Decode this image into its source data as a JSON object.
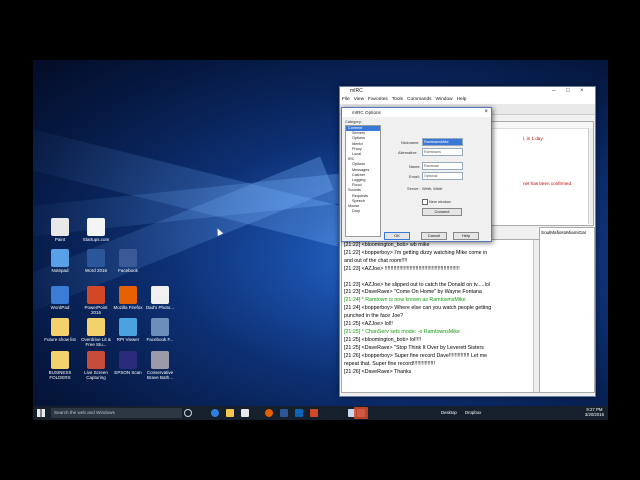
{
  "mirc": {
    "title": "mIRC",
    "menu": [
      "File",
      "View",
      "Favorites",
      "Tools",
      "Commands",
      "Window",
      "Help"
    ],
    "status_lines": [
      "l, in 1 day.",
      "net has been confirmed."
    ],
    "nicklist_top": "SoulMafiosoMiamiGar",
    "chat": [
      {
        "text": "[21:22] <bloomington_bob> wb mike",
        "color": "black"
      },
      {
        "text": "[21:22] <bopperboy> I'm getting dizzy watching Mike come in",
        "color": "black"
      },
      {
        "text": "  and out of the chat room!!!!",
        "color": "black"
      },
      {
        "text": "[21:23] <AZJoe> !!!!!!!!!!!!!!!!!!!!!!!!!!!!!!!!!!!!!!!!!!!!!!!!!!!",
        "color": "black"
      },
      {
        "text": "",
        "color": "black"
      },
      {
        "text": "[21:23] <AZJoe> he slipped out to catch  the Donald    on tv.....lol",
        "color": "black"
      },
      {
        "text": "[21:23] <DaveRave> \"Come On Home\" by Wayne Fontana",
        "color": "black"
      },
      {
        "text": "[21:24] * Ramtown is now known as RamtownsMike",
        "color": "green"
      },
      {
        "text": "[21:24] <bopperboy> Where else can you watch people getting",
        "color": "black"
      },
      {
        "text": "  punched in the face Joe?",
        "color": "black"
      },
      {
        "text": "[21:25] <AZJoe> lol!!",
        "color": "black"
      },
      {
        "text": "[21:25] * ChanServ sets mode: -o RamtownsMike",
        "color": "green"
      },
      {
        "text": "[21:25] <bloomington_bob> lol!!!!",
        "color": "black"
      },
      {
        "text": "[21:25] <DaveRave> \"Stop Think It Over by Leverett Sisters",
        "color": "black"
      },
      {
        "text": "[21:26] <bopperboy> Super fine record Dave!!!!!!!!!!!!!! Let me",
        "color": "black"
      },
      {
        "text": "  repeat that. Super fine record!!!!!!!!!!!!!!!",
        "color": "black"
      },
      {
        "text": "[21:26] <DaveRave> Thanks",
        "color": "black"
      }
    ]
  },
  "dialog": {
    "title": "mIRC Options",
    "category_label": "Category:",
    "tree": [
      "Connect",
      "Servers",
      "Options",
      "Identd",
      "Proxy",
      "Local",
      "IRC",
      "Options",
      "Messages",
      "Catcher",
      "Logging",
      "Flood",
      "Sounds",
      "Requests",
      "Speech",
      "Mouse",
      "Drop"
    ],
    "tree_selected": 0,
    "nickname_label": "Nickname:",
    "nickname_value": "RamtownsMike",
    "alternative_label": "Alternative:",
    "alternative_value": "Ramtowns",
    "name_label": "Name:",
    "name_value": "Ramtown",
    "email_label": "Email:",
    "email_value": "Optional",
    "server_label": "Server:",
    "server_value": "Wbtfr, Wbtfr",
    "new_window_label": "New window",
    "connect_label": "Connect",
    "ok": "OK",
    "cancel": "Cancel",
    "help": "Help"
  },
  "desktop_icons": [
    {
      "label": "Paint",
      "color": "#e8e8e8"
    },
    {
      "label": "Startups.com",
      "color": "#f4f4f4"
    },
    {
      "label": "Notepad",
      "color": "#5aa0e6"
    },
    {
      "label": "Word 2016",
      "color": "#2b579a"
    },
    {
      "label": "Facebook",
      "color": "#3b5998"
    },
    {
      "label": "WordPad",
      "color": "#3a7bd5"
    },
    {
      "label": "PowerPoint 2016",
      "color": "#d24726"
    },
    {
      "label": "Mozilla Firefox",
      "color": "#e66000"
    },
    {
      "label": "Dad's Photo...",
      "color": "#f0f0f0"
    },
    {
      "label": "Future show list",
      "color": "#f3d26b"
    },
    {
      "label": "Overdrive Lit & Free Stu...",
      "color": "#f3d26b"
    },
    {
      "label": "RPI Viewer",
      "color": "#4aa3df"
    },
    {
      "label": "Facebook F...",
      "color": "#6b8fb8"
    },
    {
      "label": "BUSINESS FOLDERS",
      "color": "#f3d26b"
    },
    {
      "label": "Live Screen Capturing",
      "color": "#c74b3a"
    },
    {
      "label": "EPSON Scan",
      "color": "#2a2a7a"
    },
    {
      "label": "Conservative Brave Bath...",
      "color": "#9a9aa8"
    }
  ],
  "taskbar": {
    "search_placeholder": "Search the web and Windows",
    "desktop_label": "Desktop",
    "dropbox_label": "Dropbox",
    "time": "9:27 PM",
    "date": "3/20/2016"
  }
}
